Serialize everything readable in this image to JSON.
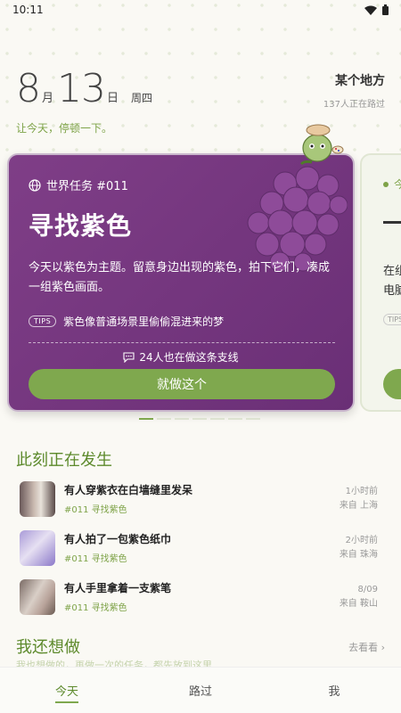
{
  "status_bar": {
    "time": "10:11"
  },
  "header": {
    "month": "8",
    "month_unit": "月",
    "day": "13",
    "day_unit": "日",
    "weekday": "周四",
    "slogan": "让今天，停顿一下。",
    "place": "某个地方",
    "place_sub": "137人正在路过"
  },
  "task_card": {
    "tag": "世界任务 #011",
    "title": "寻找紫色",
    "description": "今天以紫色为主题。留意身边出现的紫色，拍下它们，凑成一组紫色画面。",
    "tips_badge": "TIPS",
    "tips_text": "紫色像普通场景里偷偷混进来的梦",
    "people_text": "24人也在做这条支线",
    "action_label": "就做这个",
    "color": "#7a3a84"
  },
  "peek_card": {
    "label": "今",
    "text_line1": "在组",
    "text_line2": "电脑",
    "tips_badge": "TIPS"
  },
  "happening": {
    "title": "此刻正在发生",
    "items": [
      {
        "title": "有人穿紫衣在白墙缝里发呆",
        "tag": "#011 寻找紫色",
        "time": "1小时前",
        "from": "来自 上海"
      },
      {
        "title": "有人拍了一包紫色纸巾",
        "tag": "#011 寻找紫色",
        "time": "2小时前",
        "from": "来自 珠海"
      },
      {
        "title": "有人手里拿着一支紫笔",
        "tag": "#011 寻找紫色",
        "time": "8/09",
        "from": "来自 鞍山"
      }
    ]
  },
  "want": {
    "title": "我还想做",
    "more_label": "去看看 ›",
    "subtitle": "我也想做的，再做一次的任务，都先放到这里"
  },
  "tabs": [
    {
      "label": "今天",
      "active": true
    },
    {
      "label": "路过",
      "active": false
    },
    {
      "label": "我",
      "active": false
    }
  ],
  "colors": {
    "accent": "#7fa84e",
    "purple": "#7a3a84"
  }
}
